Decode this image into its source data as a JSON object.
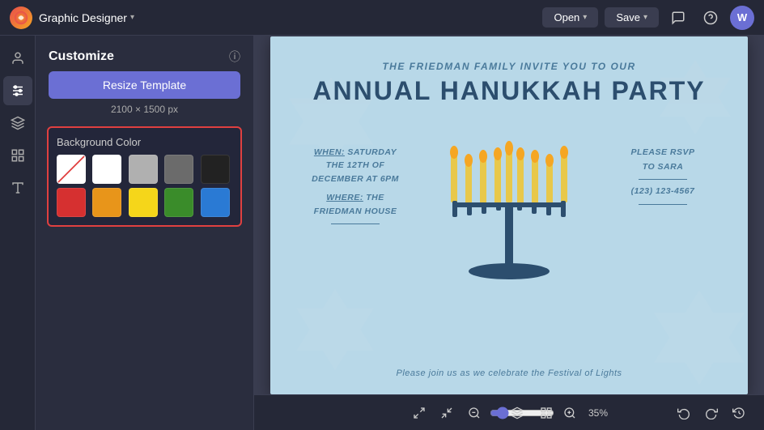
{
  "topbar": {
    "app_name": "Graphic Designer",
    "open_label": "Open",
    "save_label": "Save",
    "avatar_initial": "W"
  },
  "customize": {
    "title": "Customize",
    "resize_btn": "Resize Template",
    "dimensions": "2100 × 1500 px",
    "bg_color_label": "Background Color",
    "colors": [
      {
        "name": "transparent",
        "value": "transparent"
      },
      {
        "name": "white",
        "value": "#ffffff"
      },
      {
        "name": "light-gray",
        "value": "#b0b0b0"
      },
      {
        "name": "dark-gray",
        "value": "#6b6b6b"
      },
      {
        "name": "black",
        "value": "#222222"
      },
      {
        "name": "red",
        "value": "#d63030"
      },
      {
        "name": "orange",
        "value": "#e8951a"
      },
      {
        "name": "yellow",
        "value": "#f5d61a"
      },
      {
        "name": "green",
        "value": "#3a8c2a"
      },
      {
        "name": "blue",
        "value": "#2a7ad4"
      }
    ]
  },
  "design": {
    "subtitle": "The Friedman Family Invite You To Our",
    "title": "Annual Hanukkah Party",
    "left_text_line1": "WHEN: Saturday",
    "left_text_line2": "The 12th of",
    "left_text_line3": "December at 6pm",
    "left_text_line4": "WHERE: The",
    "left_text_line5": "Friedman House",
    "right_text_line1": "Please RSVP",
    "right_text_line2": "to Sara",
    "right_text_line3": "(123) 123-4567",
    "footer": "Please join us as we celebrate the Festival of Lights"
  },
  "bottombar": {
    "zoom_percent": "35%"
  },
  "icons": {
    "layers": "⊞",
    "grid": "⊡",
    "expand": "⤢",
    "collapse": "⤡",
    "zoom_out": "⊖",
    "zoom_in": "⊕",
    "undo": "↩",
    "redo": "↪",
    "history": "⟳"
  }
}
